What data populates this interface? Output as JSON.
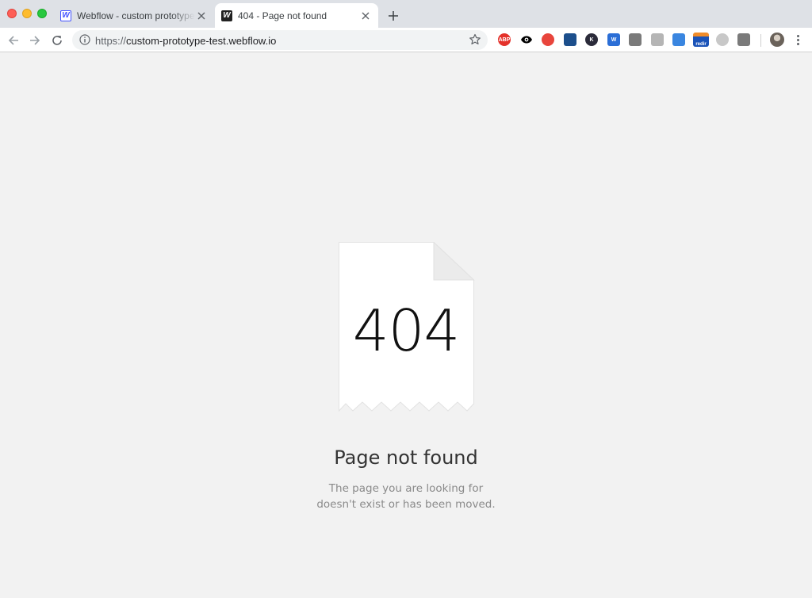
{
  "browser": {
    "tabs": [
      {
        "title": "Webflow - custom prototype test",
        "favicon": "webflow-w-icon",
        "active": false
      },
      {
        "title": "404 - Page not found",
        "favicon": "webflow-w-icon",
        "active": true
      }
    ],
    "address_bar": {
      "scheme": "https://",
      "host": "custom-prototype-test.webflow.io"
    },
    "extensions": [
      {
        "name": "adblock-plus-icon",
        "label": "ABP",
        "color": "#e4322b"
      },
      {
        "name": "eye-icon",
        "label": "",
        "color": "#000000"
      },
      {
        "name": "red-circle-extension-icon",
        "label": "",
        "color": "#e8453c"
      },
      {
        "name": "bar-chart-extension-icon",
        "label": "",
        "color": "#1c4f8c"
      },
      {
        "name": "k-extension-icon",
        "label": "K",
        "color": "#2b2b3a"
      },
      {
        "name": "w-extension-icon",
        "label": "W",
        "color": "#2b6ed6"
      },
      {
        "name": "arrow-extension-icon",
        "label": "",
        "color": "#7a7a7a"
      },
      {
        "name": "gray-extension-icon",
        "label": "",
        "color": "#b5b5b5"
      },
      {
        "name": "blue-extension-icon",
        "label": "",
        "color": "#3a86e0"
      },
      {
        "name": "redirect-extension-icon",
        "label": "redir",
        "color": "#1a53b8"
      },
      {
        "name": "light-circle-extension-icon",
        "label": "",
        "color": "#c8c8c8"
      },
      {
        "name": "satellite-extension-icon",
        "label": "",
        "color": "#7a7a7a"
      }
    ]
  },
  "page": {
    "error_code": "404",
    "headline": "Page not found",
    "message": "The page you are looking for doesn't exist or has been moved."
  },
  "colors": {
    "page_background": "#f2f2f2",
    "tabstrip": "#dee1e6",
    "webflow_blue": "#4353ff"
  }
}
